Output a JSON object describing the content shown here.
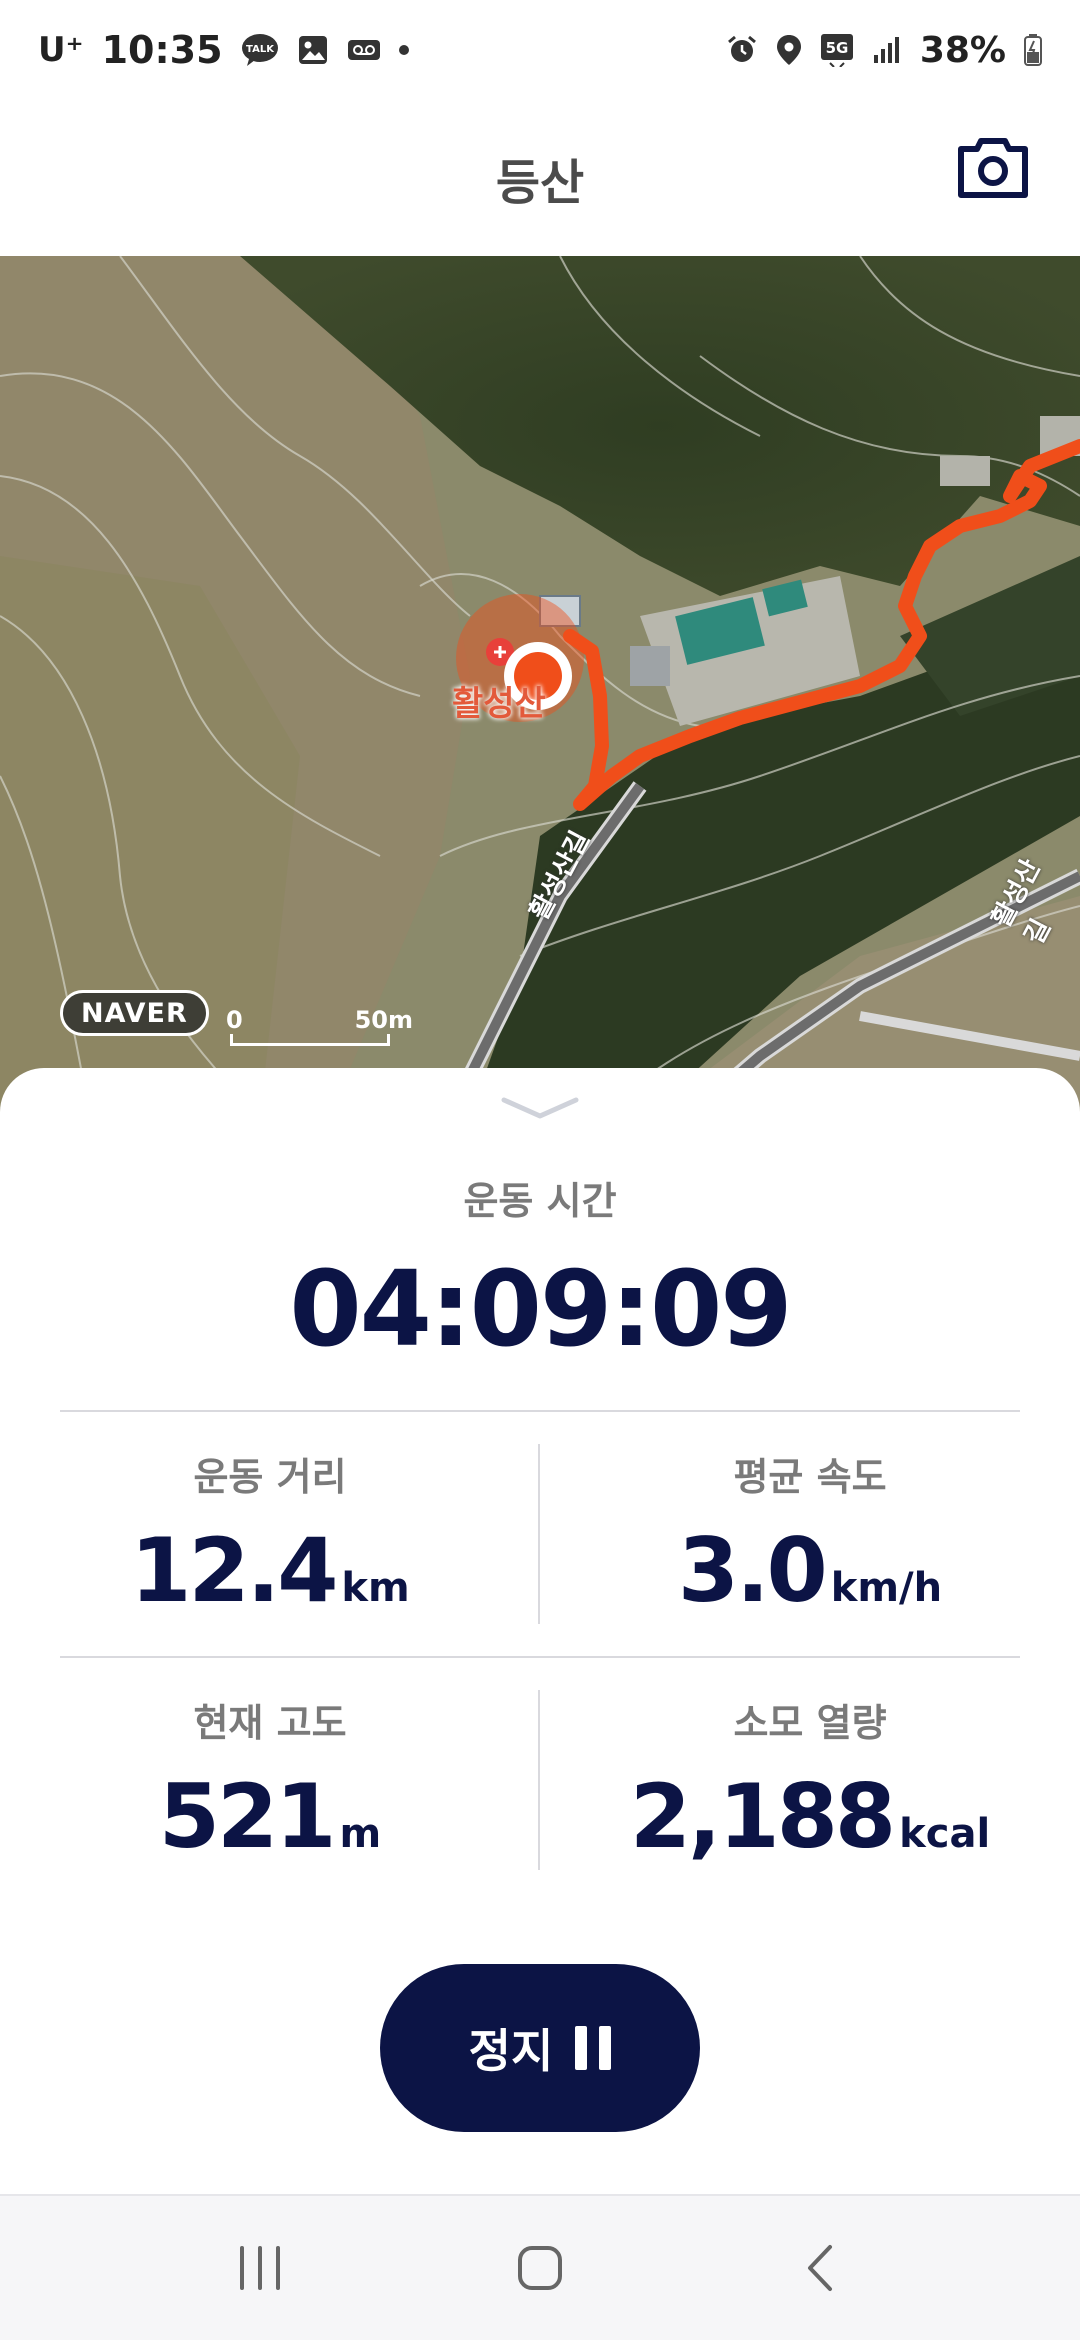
{
  "status_bar": {
    "carrier": "U⁺",
    "time": "10:35",
    "network": "5G",
    "battery": "38%",
    "icons": [
      "kakaotalk-icon",
      "gallery-icon",
      "voicemail-icon",
      "dot-icon",
      "alarm-icon",
      "location-icon",
      "5g-icon",
      "signal-icon",
      "battery-icon"
    ]
  },
  "header": {
    "title": "등산",
    "camera_icon": "camera-icon"
  },
  "map": {
    "provider": "NAVER",
    "scale_min": "0",
    "scale_max": "50m",
    "poi_label": "활성산",
    "road_label_1": "활성산길",
    "road_label_2": "활성산길",
    "route_color": "#f04e1a"
  },
  "workout": {
    "time_label": "운동 시간",
    "time_value": "04:09:09",
    "stats": [
      {
        "label": "운동 거리",
        "value": "12.4",
        "unit": "km"
      },
      {
        "label": "평균 속도",
        "value": "3.0",
        "unit": "km/h"
      },
      {
        "label": "현재 고도",
        "value": "521",
        "unit": "m"
      },
      {
        "label": "소모 열량",
        "value": "2,188",
        "unit": "kcal"
      }
    ],
    "stop_label": "정지"
  },
  "colors": {
    "primary_navy": "#0c1445",
    "label_gray": "#7a7a7a",
    "route_orange": "#f04e1a"
  },
  "navbar": {
    "icons": [
      "recent-apps-icon",
      "home-icon",
      "back-icon"
    ]
  }
}
